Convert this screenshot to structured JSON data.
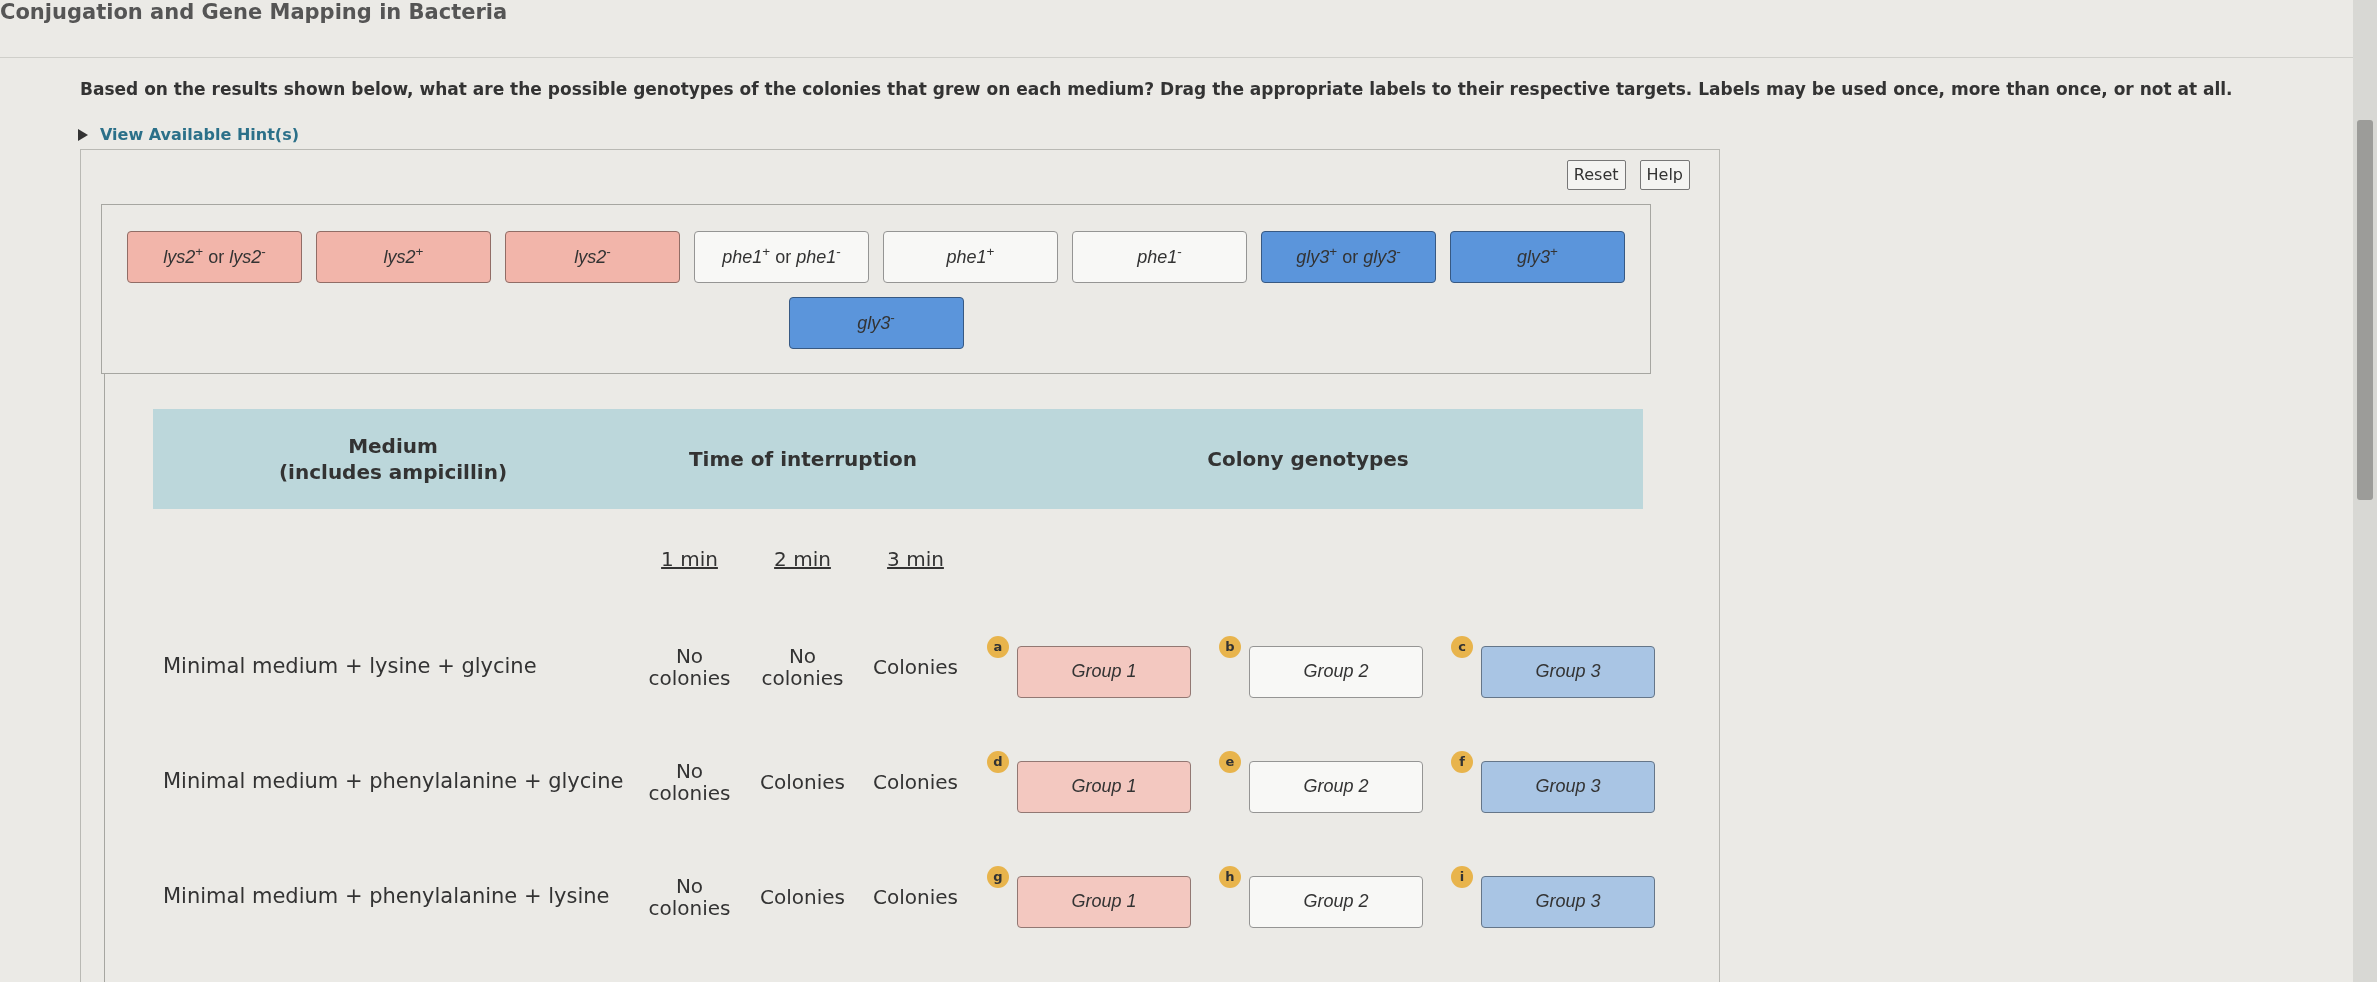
{
  "title": "Conjugation and Gene Mapping in Bacteria",
  "question": "Based on the results shown below, what are the possible genotypes of the colonies that grew on each medium? Drag the appropriate labels to their respective targets. Labels may be used once, more than once, or not at all.",
  "hint": {
    "label": "View Available Hint(s)",
    "expanded": false
  },
  "toolbar": [
    "Reset",
    "Help"
  ],
  "labels": [
    {
      "text": "*lys2*$^{+}$ or *lys2*$^{-}$",
      "color": "#f2b5aa"
    },
    {
      "text": "*lys2*$^{+}$",
      "color": "#f2b5aa"
    },
    {
      "text": "*lys2*$^{-}$",
      "color": "#f2b5aa"
    },
    {
      "text": "*phe1*$^{+}$ or *phe1*$^{-}$",
      "color": "#f8f8f6"
    },
    {
      "text": "*phe1*$^{+}$",
      "color": "#f8f8f6"
    },
    {
      "text": "*phe1*$^{-}$",
      "color": "#f8f8f6"
    },
    {
      "text": "*gly3*$^{+}$ or *gly3*$^{-}$",
      "color": "#5b95db"
    },
    {
      "text": "*gly3*$^{+}$",
      "color": "#5b95db"
    },
    {
      "text": "*gly3*$^{-}$",
      "color": "#5b95db"
    }
  ],
  "table": {
    "columns": [
      "Medium\n(includes ampicillin)",
      "Time of interruption",
      "Colony genotypes"
    ],
    "times": [
      "1 min",
      "2 min",
      "3 min"
    ],
    "rows": [
      {
        "medium": "Minimal medium + lysine + glycine",
        "results": [
          "No colonies",
          "No colonies",
          "Colonies"
        ],
        "targets": [
          {
            "letter": "a",
            "label": "Group 1",
            "color": "#f3c8c0"
          },
          {
            "letter": "b",
            "label": "Group 2",
            "color": "#f8f8f6"
          },
          {
            "letter": "c",
            "label": "Group 3",
            "color": "#a9c5e4"
          }
        ]
      },
      {
        "medium": "Minimal medium + phenylalanine + glycine",
        "results": [
          "No colonies",
          "Colonies",
          "Colonies"
        ],
        "targets": [
          {
            "letter": "d",
            "label": "Group 1",
            "color": "#f3c8c0"
          },
          {
            "letter": "e",
            "label": "Group 2",
            "color": "#f8f8f6"
          },
          {
            "letter": "f",
            "label": "Group 3",
            "color": "#a9c5e4"
          }
        ]
      },
      {
        "medium": "Minimal medium + phenylalanine + lysine",
        "results": [
          "No colonies",
          "Colonies",
          "Colonies"
        ],
        "targets": [
          {
            "letter": "g",
            "label": "Group 1",
            "color": "#f3c8c0"
          },
          {
            "letter": "h",
            "label": "Group 2",
            "color": "#f8f8f6"
          },
          {
            "letter": "i",
            "label": "Group 3",
            "color": "#a9c5e4"
          }
        ]
      }
    ]
  }
}
